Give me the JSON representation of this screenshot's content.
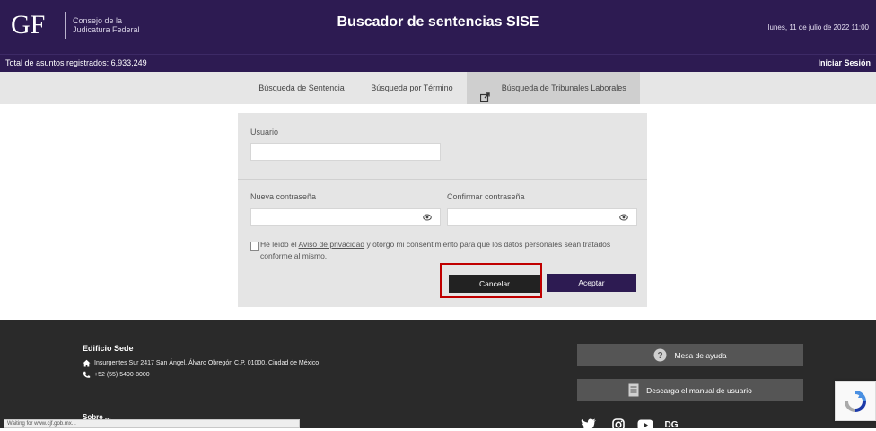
{
  "header": {
    "logo_mark": "GF",
    "logo_line1": "Consejo de la",
    "logo_line2": "Judicatura Federal",
    "title": "Buscador de sentencias SISE",
    "date": "lunes, 11 de julio de 2022 11:00"
  },
  "subbar": {
    "total_label": "Total de asuntos registrados: 6,933,249",
    "login": "Iniciar Sesión"
  },
  "tabs": [
    {
      "label": "Búsqueda de Sentencia",
      "active": false
    },
    {
      "label": "Búsqueda por Término",
      "active": false
    },
    {
      "label": "Búsqueda de Tribunales Laborales",
      "active": true,
      "icon": "external-link-icon"
    }
  ],
  "form": {
    "usuario_label": "Usuario",
    "usuario_value": "",
    "nueva_label": "Nueva contraseña",
    "nueva_value": "",
    "confirmar_label": "Confirmar contraseña",
    "confirmar_value": "",
    "consent_before": "He leído el ",
    "consent_link": "Aviso de privacidad",
    "consent_after": " y otorgo mi consentimiento para que los datos personales sean tratados conforme al mismo.",
    "cancel": "Cancelar",
    "accept": "Aceptar"
  },
  "footer": {
    "title": "Edificio Sede",
    "address": "Insurgentes Sur 2417 San Ángel, Álvaro Obregón C.P. 01000, Ciudad de México",
    "phone": "+52 (55) 5490-8000",
    "help": "Mesa de ayuda",
    "manual": "Descarga el manual de usuario",
    "sobre": "Sobre ..."
  },
  "status": "Waiting for www.cjf.gob.mx...",
  "colors": {
    "brand": "#2d1b52",
    "footer": "#2a2a2a",
    "highlight": "#c00000"
  }
}
